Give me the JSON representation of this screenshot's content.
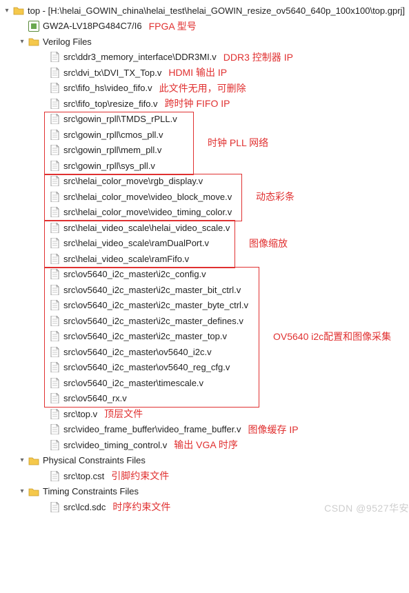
{
  "root": {
    "label": "top - [H:\\helai_GOWIN_china\\helai_test\\helai_GOWIN_resize_ov5640_640p_100x100\\top.gprj]"
  },
  "device": {
    "label": "GW2A-LV18PG484C7/I6",
    "anno": "FPGA 型号"
  },
  "folders": {
    "verilog": "Verilog Files",
    "physical": "Physical Constraints Files",
    "timing": "Timing Constraints Files"
  },
  "files": {
    "f01": {
      "label": "src\\ddr3_memory_interface\\DDR3MI.v",
      "anno": "DDR3 控制器 IP"
    },
    "f02": {
      "label": "src\\dvi_tx\\DVI_TX_Top.v",
      "anno": "HDMI 输出 IP"
    },
    "f03": {
      "label": "src\\fifo_hs\\video_fifo.v",
      "anno": "此文件无用，可删除"
    },
    "f04": {
      "label": "src\\fifo_top\\resize_fifo.v",
      "anno": "跨时钟 FIFO IP"
    },
    "f05": {
      "label": "src\\gowin_rpll\\TMDS_rPLL.v"
    },
    "f06": {
      "label": "src\\gowin_rpll\\cmos_pll.v"
    },
    "f07": {
      "label": "src\\gowin_rpll\\mem_pll.v"
    },
    "f08": {
      "label": "src\\gowin_rpll\\sys_pll.v"
    },
    "f09": {
      "label": "src\\helai_color_move\\rgb_display.v"
    },
    "f10": {
      "label": "src\\helai_color_move\\video_block_move.v"
    },
    "f11": {
      "label": "src\\helai_color_move\\video_timing_color.v"
    },
    "f12": {
      "label": "src\\helai_video_scale\\helai_video_scale.v"
    },
    "f13": {
      "label": "src\\helai_video_scale\\ramDualPort.v"
    },
    "f14": {
      "label": "src\\helai_video_scale\\ramFifo.v"
    },
    "f15": {
      "label": "src\\ov5640_i2c_master\\i2c_config.v"
    },
    "f16": {
      "label": "src\\ov5640_i2c_master\\i2c_master_bit_ctrl.v"
    },
    "f17": {
      "label": "src\\ov5640_i2c_master\\i2c_master_byte_ctrl.v"
    },
    "f18": {
      "label": "src\\ov5640_i2c_master\\i2c_master_defines.v"
    },
    "f19": {
      "label": "src\\ov5640_i2c_master\\i2c_master_top.v"
    },
    "f20": {
      "label": "src\\ov5640_i2c_master\\ov5640_i2c.v"
    },
    "f21": {
      "label": "src\\ov5640_i2c_master\\ov5640_reg_cfg.v"
    },
    "f22": {
      "label": "src\\ov5640_i2c_master\\timescale.v"
    },
    "f23": {
      "label": "src\\ov5640_rx.v"
    },
    "f24": {
      "label": "src\\top.v",
      "anno": "顶层文件"
    },
    "f25": {
      "label": "src\\video_frame_buffer\\video_frame_buffer.v",
      "anno": "图像缓存 IP"
    },
    "f26": {
      "label": "src\\video_timing_control.v",
      "anno": "输出 VGA 时序"
    },
    "f27": {
      "label": "src\\top.cst",
      "anno": "引脚约束文件"
    },
    "f28": {
      "label": "src\\lcd.sdc",
      "anno": "时序约束文件"
    }
  },
  "group_annos": {
    "pll": "时钟 PLL 网络",
    "color": "动态彩条",
    "scale": "图像缩放",
    "i2c": "OV5640 i2c配置和图像采集"
  },
  "watermark": "CSDN @9527华安"
}
